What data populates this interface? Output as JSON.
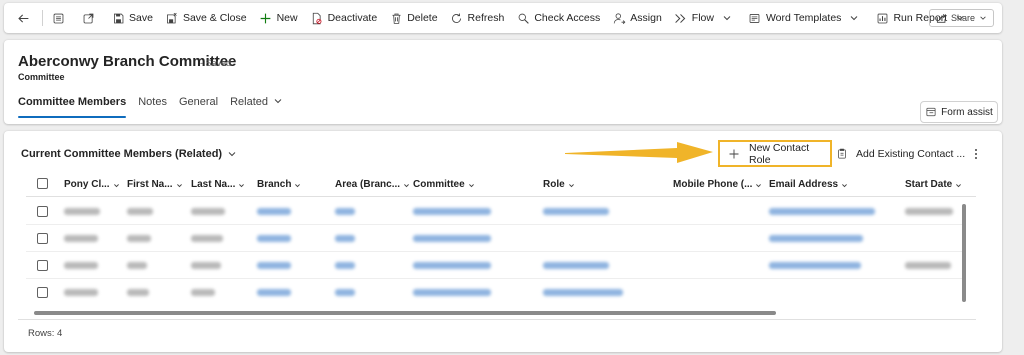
{
  "toolbar": {
    "save": "Save",
    "save_close": "Save & Close",
    "new": "New",
    "deactivate": "Deactivate",
    "delete": "Delete",
    "refresh": "Refresh",
    "check_access": "Check Access",
    "assign": "Assign",
    "flow": "Flow",
    "word_templates": "Word Templates",
    "run_report": "Run Report",
    "share": "Share"
  },
  "header": {
    "title": "Aberconwy Branch Committee",
    "saved_status": "- Saved",
    "entity": "Committee",
    "tabs": [
      "Committee Members",
      "Notes",
      "General",
      "Related"
    ],
    "form_assist": "Form assist"
  },
  "subgrid": {
    "title": "Current Committee Members (Related)",
    "new_contact_role": "New Contact Role",
    "add_existing": "Add Existing Contact ...",
    "columns": [
      "Pony Cl...",
      "First Na...",
      "Last Na...",
      "Branch",
      "Area (Branc...",
      "Committee",
      "Role",
      "Mobile Phone (...",
      "Email Address",
      "Start Date"
    ],
    "rows_label": "Rows: 4"
  },
  "colors": {
    "accent": "#0f6cbd",
    "highlight": "#f0b429",
    "arrow": "#f0b429"
  }
}
